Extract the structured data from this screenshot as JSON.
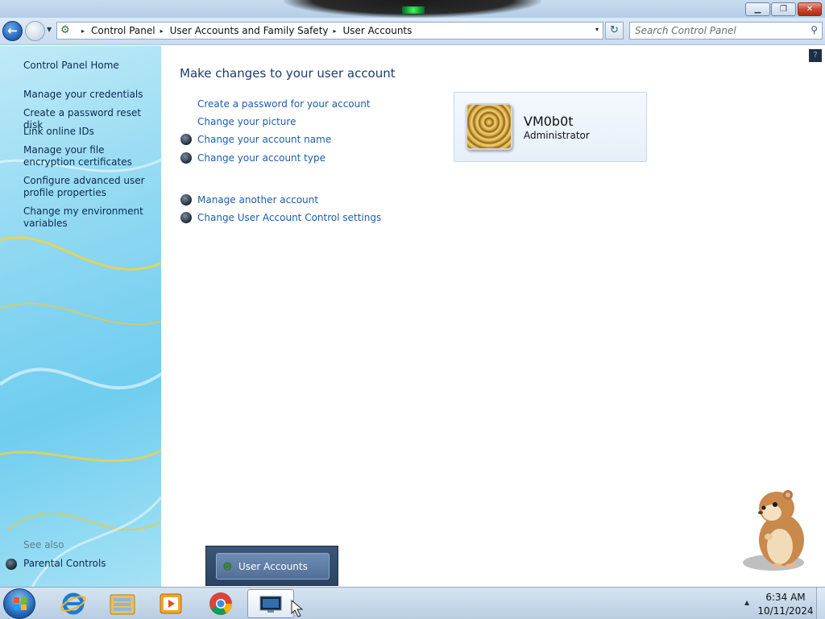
{
  "window": {
    "minimize_glyph": "▁",
    "maximize_glyph": "❐",
    "close_glyph": "✕"
  },
  "address_bar": {
    "breadcrumbs": [
      "Control Panel",
      "User Accounts and Family Safety",
      "User Accounts"
    ],
    "separator_glyph": "▸",
    "dropdown_glyph": "▾"
  },
  "search": {
    "placeholder": "Search Control Panel"
  },
  "left_pane": {
    "home": "Control Panel Home",
    "tasks": [
      "Manage your credentials",
      "Create a password reset disk",
      "Link online IDs",
      "Manage your file encryption certificates",
      "Configure advanced user profile properties",
      "Change my environment variables"
    ],
    "see_also_label": "See also",
    "see_also_items": [
      "Parental Controls"
    ]
  },
  "main": {
    "title": "Make changes to your user account",
    "tasks": [
      {
        "label": "Create a password for your account",
        "shield": false
      },
      {
        "label": "Change your picture",
        "shield": false
      },
      {
        "label": "Change your account name",
        "shield": true
      },
      {
        "label": "Change your account type",
        "shield": true
      }
    ],
    "other_tasks": [
      {
        "label": "Manage another account",
        "shield": true
      },
      {
        "label": "Change User Account Control settings",
        "shield": true
      }
    ]
  },
  "account": {
    "name": "VM0b0t",
    "type": "Administrator"
  },
  "taskbar": {
    "thumbnail_label": "User Accounts",
    "pinned": [
      "start",
      "internet-explorer",
      "windows-explorer",
      "windows-media-player",
      "google-chrome",
      "control-panel"
    ],
    "active": "control-panel",
    "clock_time": "6:34 AM",
    "clock_date": "10/11/2024"
  },
  "colors": {
    "link": "#1c5ea8",
    "title": "#1e3c6e",
    "left_link": "#0b2a52",
    "left_pane": "#6fcdef"
  }
}
